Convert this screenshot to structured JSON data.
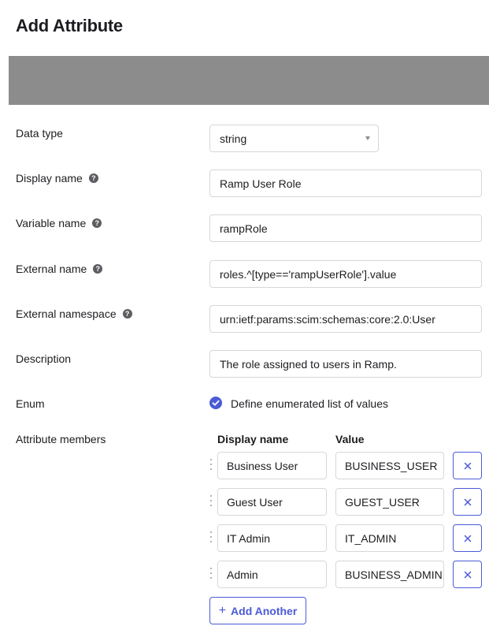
{
  "dialog": {
    "title": "Add Attribute"
  },
  "colors": {
    "accent": "#4a5bd6",
    "banner": "#8c8c8c",
    "border": "#d7d7dc"
  },
  "form": {
    "data_type": {
      "label": "Data type",
      "value": "string"
    },
    "display_name": {
      "label": "Display name",
      "value": "Ramp User Role",
      "help_icon": "question-circle-icon"
    },
    "variable_name": {
      "label": "Variable name",
      "value": "rampRole",
      "help_icon": "question-circle-icon"
    },
    "external_name": {
      "label": "External name",
      "value": "roles.^[type=='rampUserRole'].value",
      "help_icon": "question-circle-icon"
    },
    "external_namespace": {
      "label": "External namespace",
      "value": "urn:ietf:params:scim:schemas:core:2.0:User",
      "help_icon": "question-circle-icon"
    },
    "description": {
      "label": "Description",
      "value": "The role assigned to users in Ramp."
    },
    "enum": {
      "label": "Enum",
      "checkbox_label": "Define enumerated list of values",
      "checked": true
    }
  },
  "members": {
    "label": "Attribute members",
    "col_display_name": "Display name",
    "col_value": "Value",
    "rows": [
      {
        "display_name": "Business User",
        "value": "BUSINESS_USER"
      },
      {
        "display_name": "Guest User",
        "value": "GUEST_USER"
      },
      {
        "display_name": "IT Admin",
        "value": "IT_ADMIN"
      },
      {
        "display_name": "Admin",
        "value": "BUSINESS_ADMIN"
      }
    ],
    "add_label": "Add Another"
  }
}
